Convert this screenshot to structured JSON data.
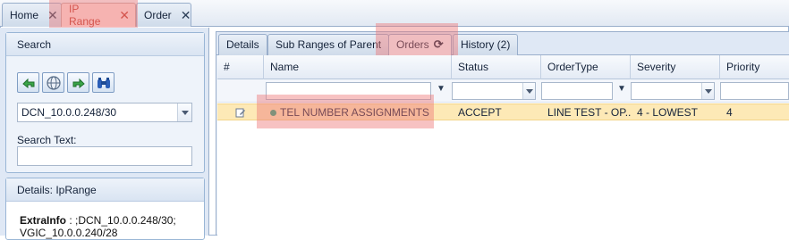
{
  "top_tabs": [
    {
      "label": "Home",
      "close": "✕"
    },
    {
      "label": "IP Range",
      "close": "✕"
    },
    {
      "label": "Order",
      "close": "✕"
    }
  ],
  "search_panel": {
    "title": "Search",
    "toolbar_icons": [
      "back-arrow-icon",
      "globe-icon",
      "forward-arrow-icon",
      "binoculars-icon"
    ],
    "selected_value": "DCN_10.0.0.248/30",
    "search_text_label": "Search Text:",
    "search_text_value": ""
  },
  "details_panel": {
    "title": "Details: IpRange",
    "extra_label": "ExtraInfo",
    "extra_value": " : ;DCN_10.0.0.248/30; VGIC_10.0.0.240/28"
  },
  "sub_tabs": [
    {
      "label": "Details"
    },
    {
      "label": "Sub Ranges of Parent"
    },
    {
      "label": "Orders",
      "icon": "refresh-icon"
    },
    {
      "label": "History (2)"
    }
  ],
  "grid": {
    "columns": [
      "#",
      "Name",
      "Status",
      "OrderType",
      "Severity",
      "Priority"
    ],
    "filter_icon": "filter-icon",
    "rows": [
      {
        "name": "TEL NUMBER ASSIGNMENTS",
        "status": "ACCEPT",
        "order_type": "LINE TEST - OP...",
        "severity": "4 - LOWEST",
        "priority": "4"
      }
    ]
  },
  "colors": {
    "accent_active_tab": "#c0392b",
    "highlight_row": "#fde9b6",
    "status_dot": "#2aa77d",
    "border": "#99aecb"
  }
}
